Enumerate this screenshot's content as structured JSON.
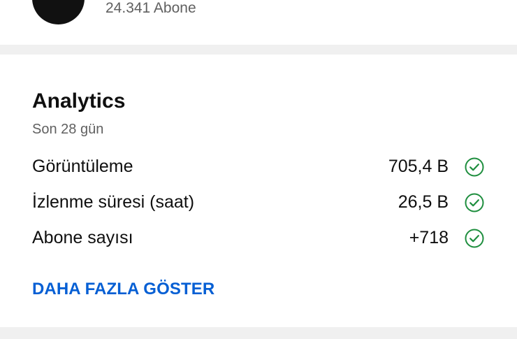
{
  "channel": {
    "subscriber_count": "24.341 Abone"
  },
  "analytics": {
    "title": "Analytics",
    "period": "Son 28 gün",
    "metrics": [
      {
        "label": "Görüntüleme",
        "value": "705,4 B",
        "status_icon": "check-circle-icon"
      },
      {
        "label": "İzlenme süresi (saat)",
        "value": "26,5 B",
        "status_icon": "check-circle-icon"
      },
      {
        "label": "Abone sayısı",
        "value": "+718",
        "status_icon": "check-circle-icon"
      }
    ],
    "show_more_label": "DAHA FAZLA GÖSTER"
  },
  "colors": {
    "link_blue": "#065fd4",
    "check_green": "#1e8e3e",
    "secondary_text": "#606060",
    "divider": "#f0f0f0"
  }
}
